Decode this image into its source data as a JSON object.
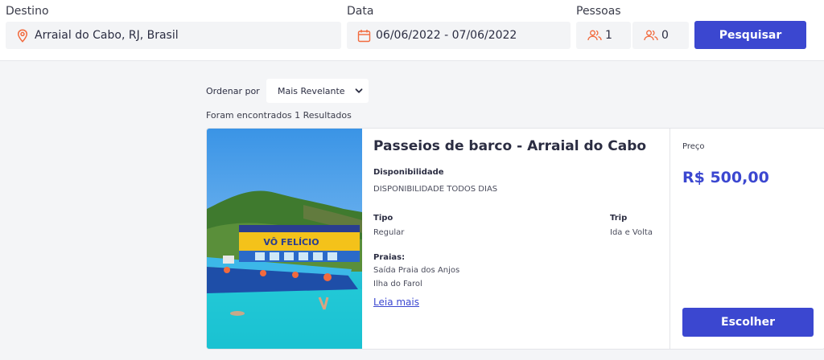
{
  "search": {
    "destination_label": "Destino",
    "destination_value": "Arraial do Cabo, RJ, Brasil",
    "date_label": "Data",
    "date_value": "06/06/2022 - 07/06/2022",
    "people_label": "Pessoas",
    "adults_value": "1",
    "children_value": "0",
    "search_button": "Pesquisar"
  },
  "results": {
    "sort_label": "Ordenar por",
    "sort_selected": "Mais Revelante",
    "count_text": "Foram encontrados 1 Resultados"
  },
  "card": {
    "title": "Passeios de barco - Arraial do Cabo",
    "availability_label": "Disponibilidade",
    "availability_value": "DISPONIBILIDADE TODOS DIAS",
    "type_label": "Tipo",
    "type_value": "Regular",
    "trip_label": "Trip",
    "trip_value": "Ida e Volta",
    "beaches_label": "Praias:",
    "beaches": [
      "Saída Praia dos Anjos",
      "Ilha do Farol"
    ],
    "read_more": "Leia mais",
    "price_label": "Preço",
    "price_value": "R$ 500,00",
    "choose_button": "Escolher",
    "boat_name": "VÔ FELÍCIO"
  },
  "colors": {
    "accent": "#3b47d0",
    "icon_orange": "#f26a3d"
  },
  "icons": {
    "destination": "map-pin-icon",
    "date": "calendar-icon",
    "adults": "users-icon",
    "children": "users-icon",
    "sort": "chevron-down-icon"
  }
}
